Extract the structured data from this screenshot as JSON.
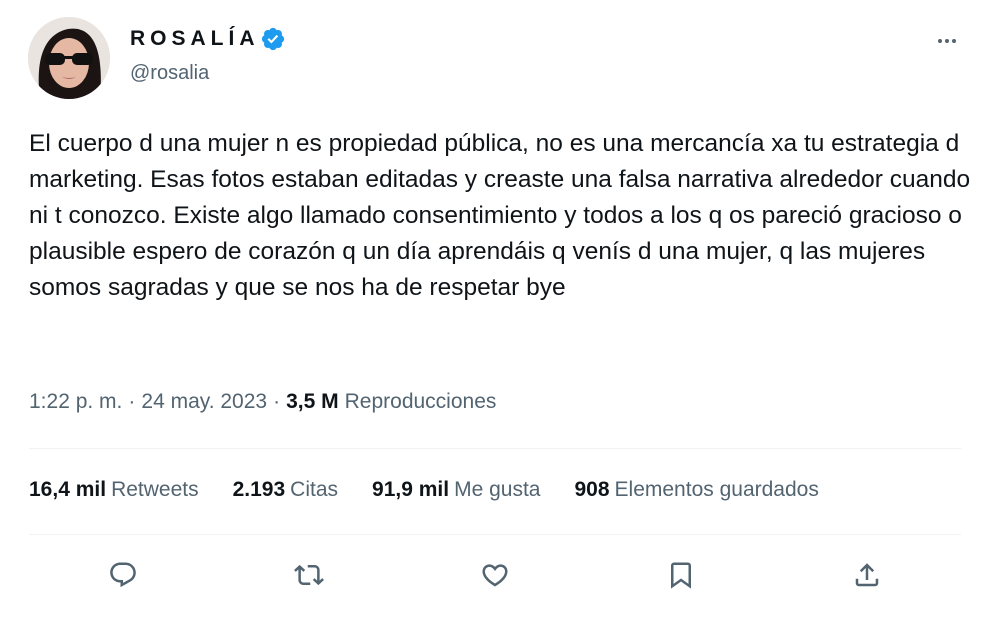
{
  "author": {
    "display_name": "ROSALÍA",
    "handle": "@rosalia",
    "verified": true,
    "verified_color": "#1d9bf0"
  },
  "tweet": {
    "text": "El cuerpo d una mujer n es propiedad pública, no es una mercancía xa tu estrategia d marketing. Esas fotos estaban editadas y creaste una falsa narrativa alrededor cuando ni t conozco. Existe algo llamado consentimiento y todos a los q os pareció gracioso o plausible espero de corazón q un día aprendáis q venís d una mujer, q las mujeres somos sagradas y que se nos ha de respetar bye",
    "time": "1:22 p. m.",
    "separator": "·",
    "date": "24 may. 2023",
    "views_count": "3,5 M",
    "views_label": "Reproducciones"
  },
  "stats": [
    {
      "count": "16,4 mil",
      "label": "Retweets"
    },
    {
      "count": "2.193",
      "label": "Citas"
    },
    {
      "count": "91,9 mil",
      "label": "Me gusta"
    },
    {
      "count": "908",
      "label": "Elementos guardados"
    }
  ],
  "actions": [
    {
      "icon": "reply-icon"
    },
    {
      "icon": "retweet-icon"
    },
    {
      "icon": "like-icon"
    },
    {
      "icon": "bookmark-icon"
    },
    {
      "icon": "share-icon"
    }
  ],
  "colors": {
    "text_primary": "#0f1419",
    "text_secondary": "#536471",
    "divider": "#eff3f4"
  }
}
